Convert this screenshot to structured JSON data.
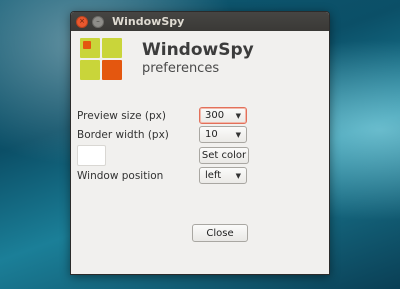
{
  "window": {
    "title": "WindowSpy"
  },
  "header": {
    "app_name": "WindowSpy",
    "subtitle": "preferences"
  },
  "titlebar": {
    "close_glyph": "×",
    "minimize_glyph": "–"
  },
  "logo": {
    "colors": [
      "#c9d53a",
      "#e4570f",
      "#e4570f"
    ]
  },
  "form": {
    "preview_size": {
      "label": "Preview size (px)",
      "value": "300"
    },
    "border_width": {
      "label": "Border width (px)",
      "value": "10"
    },
    "color": {
      "button_label": "Set color",
      "swatch": "#ffffff"
    },
    "window_position": {
      "label": "Window position",
      "value": "left"
    }
  },
  "footer": {
    "close_label": "Close"
  },
  "icons": {
    "dropdown": "▼"
  }
}
